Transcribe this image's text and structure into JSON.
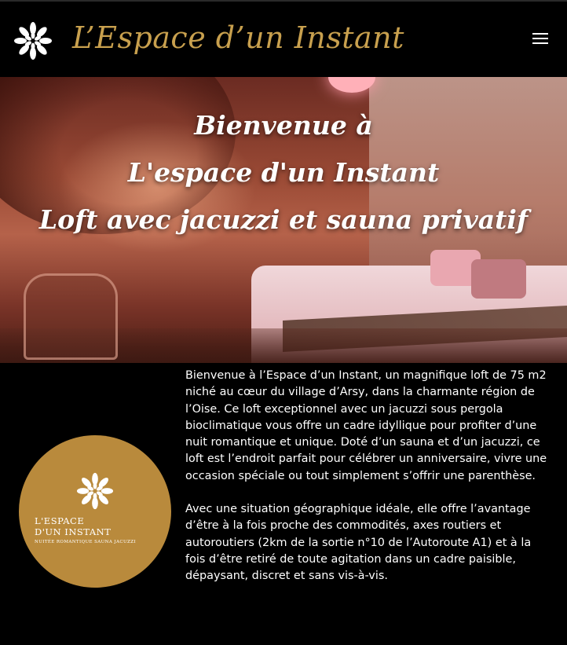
{
  "header": {
    "title": "L’Espace d’un Instant",
    "logo_icon": "mandala-logo-icon",
    "menu_icon": "hamburger-menu-icon",
    "title_color": "#c8a04e"
  },
  "hero": {
    "line1": "Bienvenue à",
    "line2": "L'espace d'un Instant",
    "line3": "Loft avec jacuzzi et sauna privatif"
  },
  "badge": {
    "color": "#b98a3c",
    "line1": "L'ESPACE",
    "line2": "D'UN INSTANT",
    "line3": "NUITÉE ROMANTIQUE SAUNA JACUZZI"
  },
  "body": {
    "paragraph1": "Bienvenue à l’Espace d’un Instant, un magnifique loft de 75 m2 niché au cœur du village d’Arsy, dans la charmante région de l’Oise. Ce loft exceptionnel avec un jacuzzi sous pergola bioclimatique vous offre un cadre idyllique pour profiter d’une nuit romantique et unique. Doté d’un sauna et d’un jacuzzi, ce loft est l’endroit parfait pour célébrer un anniversaire, vivre une occasion spéciale ou tout simplement s’offrir une parenthèse.",
    "paragraph2": "Avec une situation géographique idéale, elle offre l’avantage d’être à la fois proche des commodités, axes routiers et autoroutiers (2km de la sortie n°10 de l’Autoroute A1) et à la fois d’être retiré de toute agitation dans un cadre paisible, dépaysant, discret et sans vis-à-vis."
  }
}
